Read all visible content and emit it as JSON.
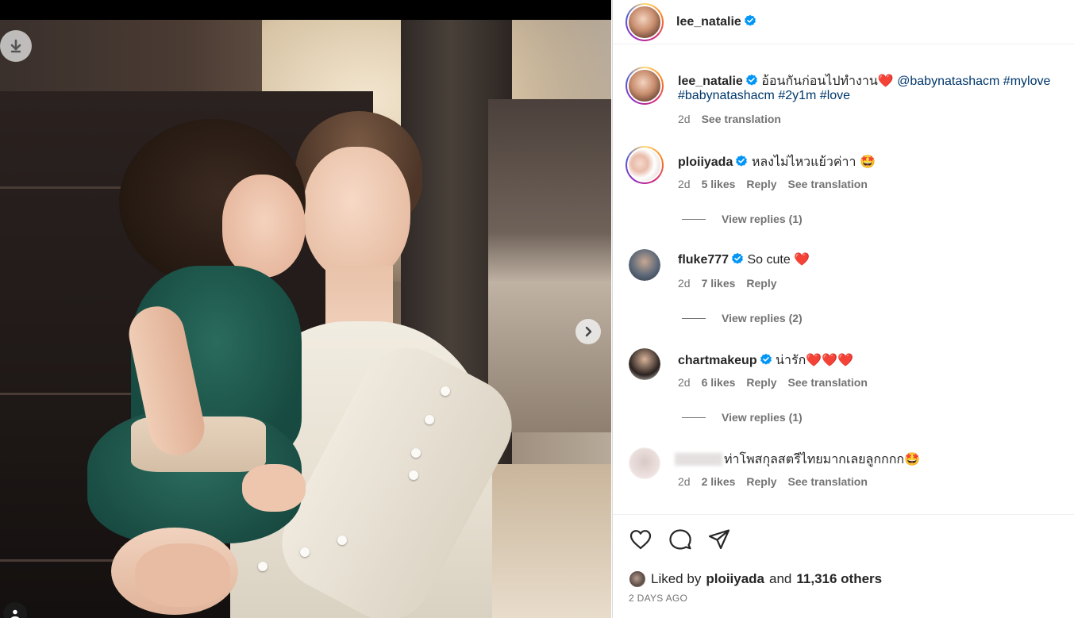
{
  "header": {
    "username": "lee_natalie"
  },
  "caption": {
    "username": "lee_natalie",
    "text": "อ้อนกันก่อนไปทำงาน",
    "heart": "❤️",
    "mention": "@babynatashacm",
    "tag_mylove": "#mylove",
    "tag_baby": "#babynatashacm",
    "tag_age": "#2y1m",
    "tag_love": "#love",
    "time": "2d",
    "see_translation": "See translation"
  },
  "comments": [
    {
      "username": "ploiiyada",
      "text": "หลงไม่ไหวแย้วค่าา 🤩",
      "time": "2d",
      "likes": "5 likes",
      "reply": "Reply",
      "see_translation": "See translation",
      "view_replies": "View replies (1)"
    },
    {
      "username": "fluke777",
      "text": "So cute ❤️",
      "time": "2d",
      "likes": "7 likes",
      "reply": "Reply",
      "view_replies": "View replies (2)"
    },
    {
      "username": "chartmakeup",
      "text": "น่ารัก❤️❤️❤️",
      "time": "2d",
      "likes": "6 likes",
      "reply": "Reply",
      "see_translation": "See translation",
      "view_replies": "View replies (1)"
    },
    {
      "username": "",
      "text": "ท่าโพสกุลสตรีไทยมากเลยลูกกกก🤩",
      "time": "2d",
      "likes": "2 likes",
      "reply": "Reply",
      "see_translation": "See translation"
    }
  ],
  "likes": {
    "prefix": "Liked by",
    "first_user": "ploiiyada",
    "and": "and",
    "others": "11,316 others"
  },
  "post_age": "2 DAYS AGO",
  "icons": {
    "download": "download-arrow-icon",
    "next": "chevron-right-icon",
    "tag": "user-tag-icon",
    "like": "heart-outline-icon",
    "comment": "comment-bubble-icon",
    "share": "paper-plane-icon",
    "verified": "verified-badge-icon"
  },
  "colors": {
    "verified": "#0095f6",
    "link": "#00376b",
    "muted": "#737373"
  }
}
